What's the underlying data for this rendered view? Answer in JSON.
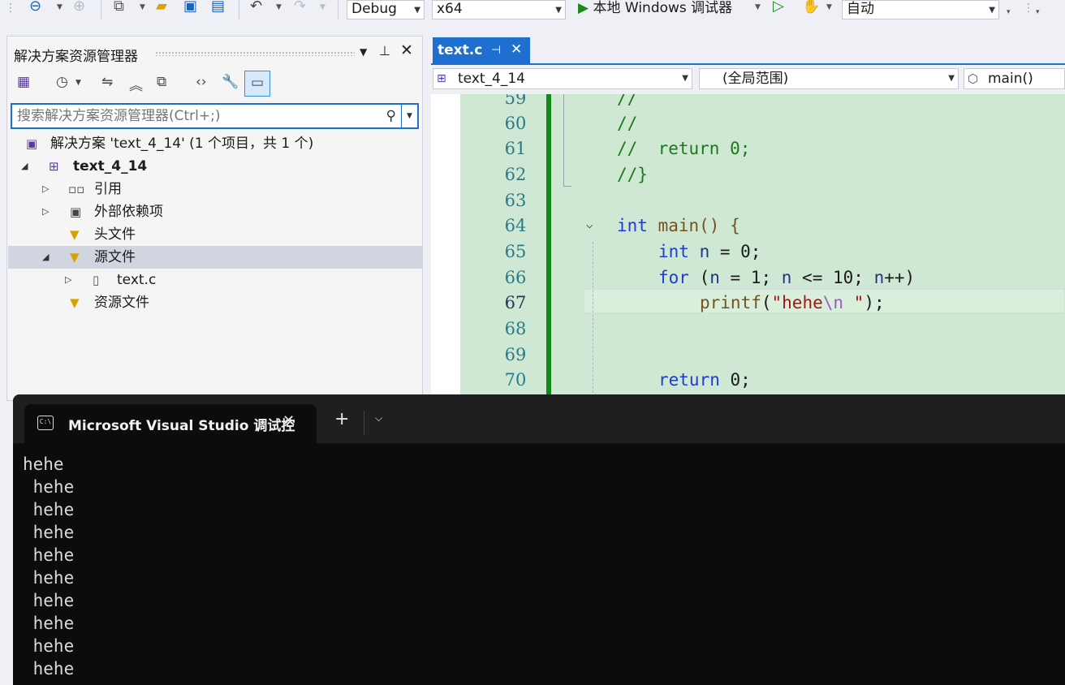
{
  "toolbar": {
    "config": "Debug",
    "platform": "x64",
    "run_label": "本地 Windows 调试器",
    "zoom_select": "自动",
    "icons": [
      "back-icon",
      "forward-icon",
      "new-project-icon",
      "open-folder-icon",
      "save-icon",
      "save-all-icon",
      "undo-icon",
      "redo-icon",
      "start-without-debug-icon",
      "hot-reload-icon"
    ]
  },
  "solution_explorer": {
    "title": "解决方案资源管理器",
    "search_placeholder": "搜索解决方案资源管理器(Ctrl+;)",
    "tree": {
      "solution": "解决方案 'text_4_14' (1 个项目，共 1 个)",
      "project": "text_4_14",
      "references": "引用",
      "external_deps": "外部依赖项",
      "headers": "头文件",
      "sources": "源文件",
      "source_file": "text.c",
      "resources": "资源文件"
    }
  },
  "editor": {
    "tab_label": "text.c",
    "nav": {
      "project": "text_4_14",
      "scope": "(全局范围)",
      "member": "main()"
    },
    "lines": [
      {
        "no": "59",
        "text": "//"
      },
      {
        "no": "60",
        "text": "//"
      },
      {
        "no": "61",
        "text": "//  return 0;"
      },
      {
        "no": "62",
        "text": "//}"
      },
      {
        "no": "63",
        "text": ""
      },
      {
        "no": "64",
        "text": "int main() {"
      },
      {
        "no": "65",
        "text": "int n = 0;"
      },
      {
        "no": "66",
        "text": "for (n = 1; n <= 10; n++)"
      },
      {
        "no": "67",
        "text": "printf(\"hehe\\n \");"
      },
      {
        "no": "68",
        "text": ""
      },
      {
        "no": "69",
        "text": ""
      },
      {
        "no": "70",
        "text": "return 0;"
      }
    ],
    "tokens": {
      "l64_kw": "int",
      "l64_rest": " main() {",
      "l65_kw": "int",
      "l65_var": " n",
      "l65_rest": " = 0;",
      "l66_kw": "for",
      "l66_a": " (",
      "l66_n1": "n",
      "l66_b": " = 1; ",
      "l66_n2": "n",
      "l66_c": " <= 10; ",
      "l66_n3": "n",
      "l66_d": "++)",
      "l67_fn": "printf",
      "l67_p": "(",
      "l67_s1": "\"hehe",
      "l67_esc": "\\n",
      "l67_s2": " \"",
      "l67_end": ");",
      "l70_kw": "return",
      "l70_rest": " 0;"
    }
  },
  "terminal": {
    "tab_title": "Microsoft Visual Studio 调试控",
    "output": "hehe\n hehe\n hehe\n hehe\n hehe\n hehe\n hehe\n hehe\n hehe\n hehe"
  }
}
